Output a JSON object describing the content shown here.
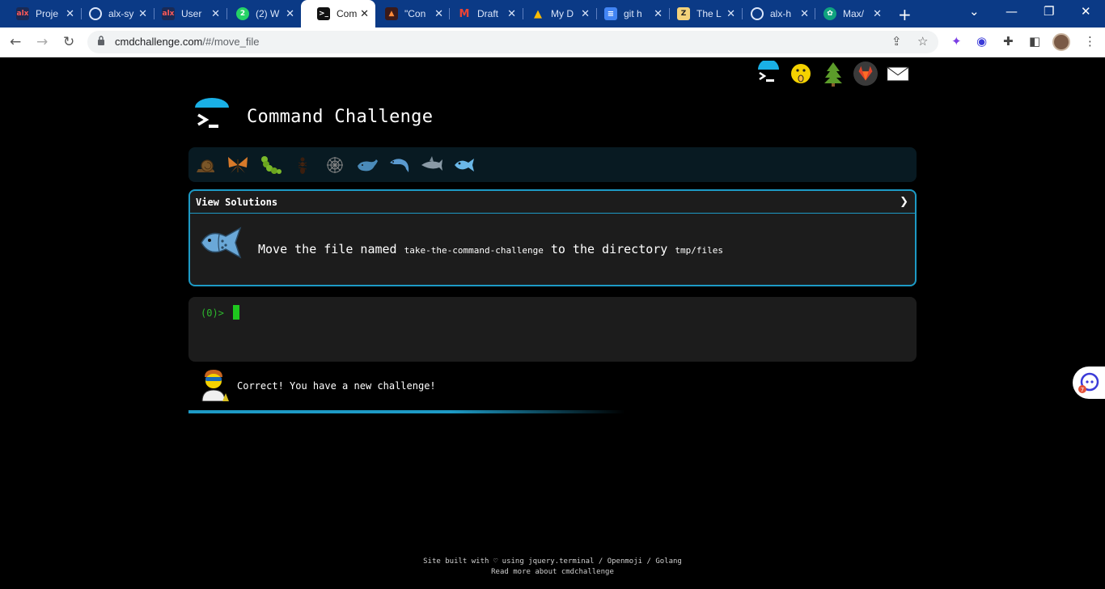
{
  "browser": {
    "tabs": [
      {
        "title": "Proje",
        "favicon": "alx-logo"
      },
      {
        "title": "alx-sy",
        "favicon": "github-icon"
      },
      {
        "title": "User",
        "favicon": "alx-logo"
      },
      {
        "title": "(2) W",
        "favicon": "whatsapp-icon"
      },
      {
        "title": "Com",
        "favicon": "terminal-icon"
      },
      {
        "title": "\"Con",
        "favicon": "video-icon"
      },
      {
        "title": "Draft",
        "favicon": "gmail-icon"
      },
      {
        "title": "My D",
        "favicon": "drive-icon"
      },
      {
        "title": "git h",
        "favicon": "docs-icon"
      },
      {
        "title": "The L",
        "favicon": "site-icon"
      },
      {
        "title": "alx-h",
        "favicon": "github-icon"
      },
      {
        "title": "Max/",
        "favicon": "chatgpt-icon"
      }
    ],
    "active_tab_index": 4,
    "url_host": "cmdchallenge.com",
    "url_path": "/#/move_file"
  },
  "page": {
    "title": "Command Challenge",
    "view_solutions_label": "View Solutions",
    "challenge": {
      "text_prefix": "Move the file named ",
      "file_name": "take-the-command-challenge",
      "text_middle": " to the directory ",
      "directory": "tmp/files"
    },
    "terminal": {
      "prompt": "(0)> "
    },
    "result_message": "Correct! You have a new challenge!",
    "progress_fraction": 0.6,
    "footer": {
      "line1": "Site built with ♡ using jquery.terminal / Openmoji / Golang",
      "line2": "Read more about cmdchallenge"
    },
    "accent_color": "#1d9ac5",
    "prompt_color": "#2db92d"
  }
}
